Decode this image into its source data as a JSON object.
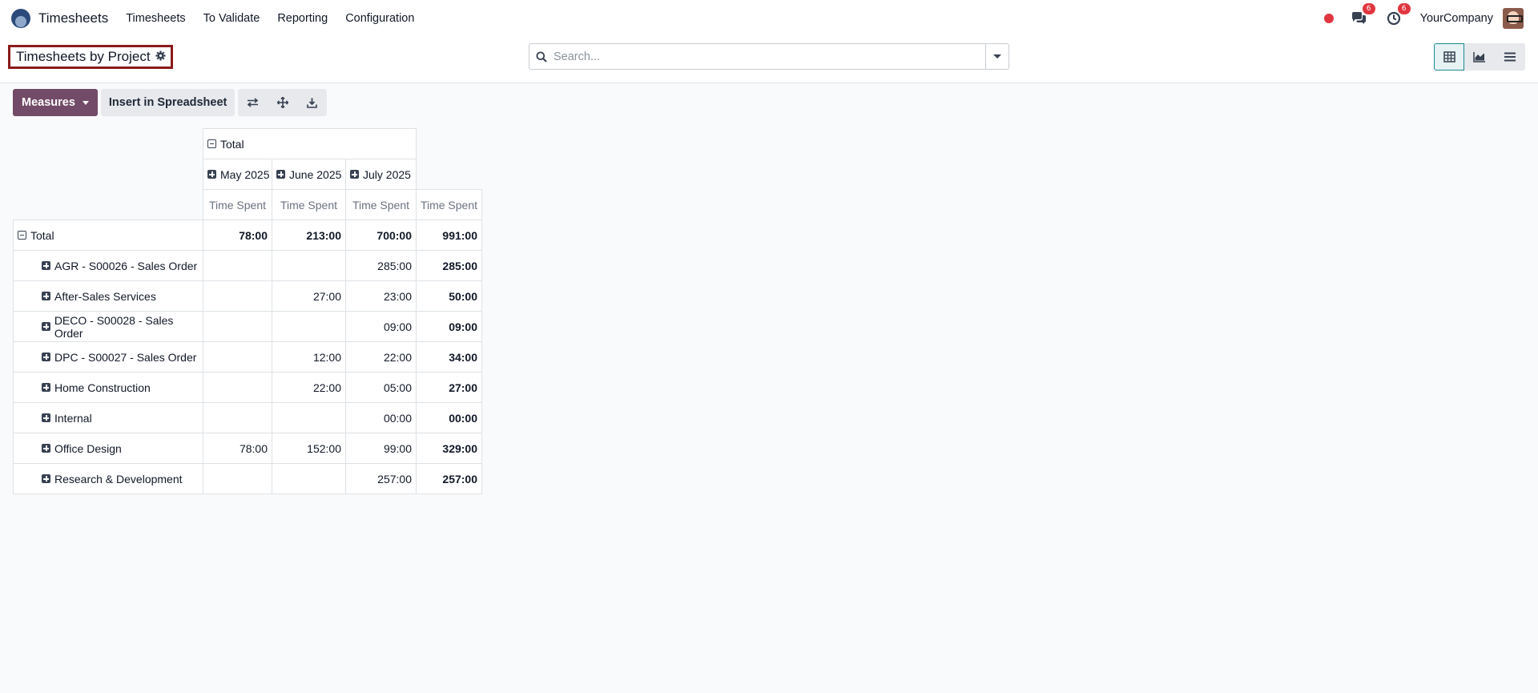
{
  "navbar": {
    "app_name": "Timesheets",
    "menu": [
      "Timesheets",
      "To Validate",
      "Reporting",
      "Configuration"
    ],
    "discuss_badge": "6",
    "activity_badge": "6",
    "company": "YourCompany"
  },
  "control_panel": {
    "breadcrumb_title": "Timesheets by Project",
    "search_placeholder": "Search..."
  },
  "toolbar": {
    "measures_label": "Measures",
    "insert_label": "Insert in Spreadsheet"
  },
  "pivot": {
    "col_total_label": "Total",
    "col_groups": [
      "May 2025",
      "June 2025",
      "July 2025"
    ],
    "measure_label": "Time Spent",
    "row_total_label": "Total",
    "total_values": [
      "78:00",
      "213:00",
      "700:00",
      "991:00"
    ],
    "rows": [
      {
        "label": "AGR - S00026 - Sales Order",
        "values": [
          "",
          "",
          "285:00",
          "285:00"
        ]
      },
      {
        "label": "After-Sales Services",
        "values": [
          "",
          "27:00",
          "23:00",
          "50:00"
        ]
      },
      {
        "label": "DECO - S00028 - Sales Order",
        "values": [
          "",
          "",
          "09:00",
          "09:00"
        ]
      },
      {
        "label": "DPC - S00027 - Sales Order",
        "values": [
          "",
          "12:00",
          "22:00",
          "34:00"
        ]
      },
      {
        "label": "Home Construction",
        "values": [
          "",
          "22:00",
          "05:00",
          "27:00"
        ]
      },
      {
        "label": "Internal",
        "values": [
          "",
          "",
          "00:00",
          "00:00"
        ]
      },
      {
        "label": "Office Design",
        "values": [
          "78:00",
          "152:00",
          "99:00",
          "329:00"
        ]
      },
      {
        "label": "Research & Development",
        "values": [
          "",
          "",
          "257:00",
          "257:00"
        ]
      }
    ]
  },
  "colors": {
    "primary": "#714b67",
    "breadcrumb_outline": "#8b1a1a",
    "badge": "#e0363f",
    "active_view": "#1b8a93"
  },
  "icons": {
    "view_buttons": [
      "pivot-view-icon",
      "graph-view-icon",
      "list-view-icon"
    ],
    "toolbar_icons": [
      "flip-axis-icon",
      "expand-all-icon",
      "download-icon"
    ]
  }
}
